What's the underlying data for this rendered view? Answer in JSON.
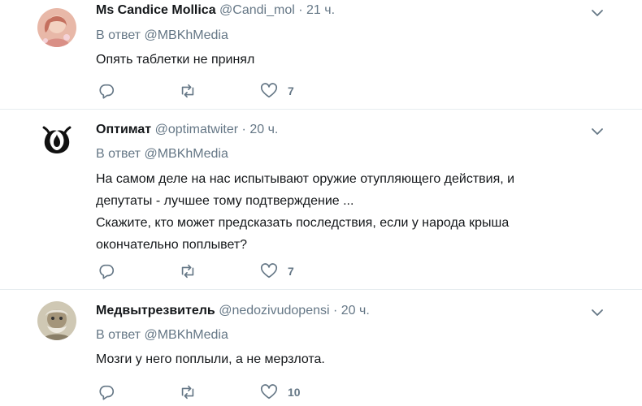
{
  "reply_prefix": "В ответ",
  "tweets": [
    {
      "name": "Ms Candice Mollica",
      "handle": "@Candi_mol",
      "separator": "·",
      "time": "21 ч.",
      "reply_to": "@MBKhMedia",
      "lines": [
        "Опять таблетки не принял"
      ],
      "likes": "7"
    },
    {
      "name": "Оптимат",
      "handle": "@optimatwiter",
      "separator": "·",
      "time": "20 ч.",
      "reply_to": "@MBKhMedia",
      "lines": [
        "На самом деле на нас испытывают оружие отупляющего действия, и",
        "депутаты - лучшее тому подтверждение ...",
        "Скажите, кто может предсказать последствия, если у народа крыша",
        "окончательно поплывет?"
      ],
      "likes": "7"
    },
    {
      "name": "Медвытрезвитель",
      "handle": "@nedozivudopensi",
      "separator": "·",
      "time": "20 ч.",
      "reply_to": "@MBKhMedia",
      "lines": [
        "Мозги у него поплыли, а не мерзлота."
      ],
      "likes": "10"
    }
  ],
  "colors": {
    "text": "#14171a",
    "secondary": "#657786",
    "divider": "#e6ecf0"
  }
}
